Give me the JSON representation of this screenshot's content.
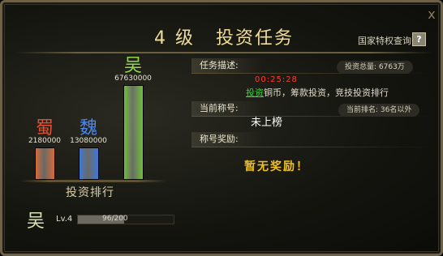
{
  "title": {
    "level": "4",
    "level_suffix": "级",
    "text": "投资任务"
  },
  "header": {
    "privilege_link": "国家特权查询",
    "help_icon": "?",
    "close_icon": "x"
  },
  "chart_data": {
    "type": "bar",
    "title": "投资排行",
    "categories": [
      "蜀",
      "魏",
      "吴"
    ],
    "values": [
      2180000,
      13080000,
      67630000
    ],
    "value_labels": [
      "2180000",
      "13080000",
      "67630000"
    ],
    "colors": [
      "#d86a3a",
      "#3f78d6",
      "#6fbf3a"
    ],
    "name_colors": [
      "#e05030",
      "#4a86f0",
      "#8fd84a"
    ]
  },
  "player": {
    "name": "吴",
    "level": "Lv.4",
    "xp_text": "96/200",
    "xp_fraction": 0.48
  },
  "task": {
    "desc_label": "任务描述:",
    "total_label": "投资总量: 6763万",
    "timer": "00:25:28",
    "desc_link": "投资",
    "desc_rest": "铜币，筹款投资，竞技投资排行"
  },
  "title_section": {
    "label": "当前称号:",
    "rank_pill": "当前排名: 36名以外",
    "current": "未上榜"
  },
  "reward_section": {
    "label": "称号奖励:",
    "reward": "暂无奖励！"
  }
}
